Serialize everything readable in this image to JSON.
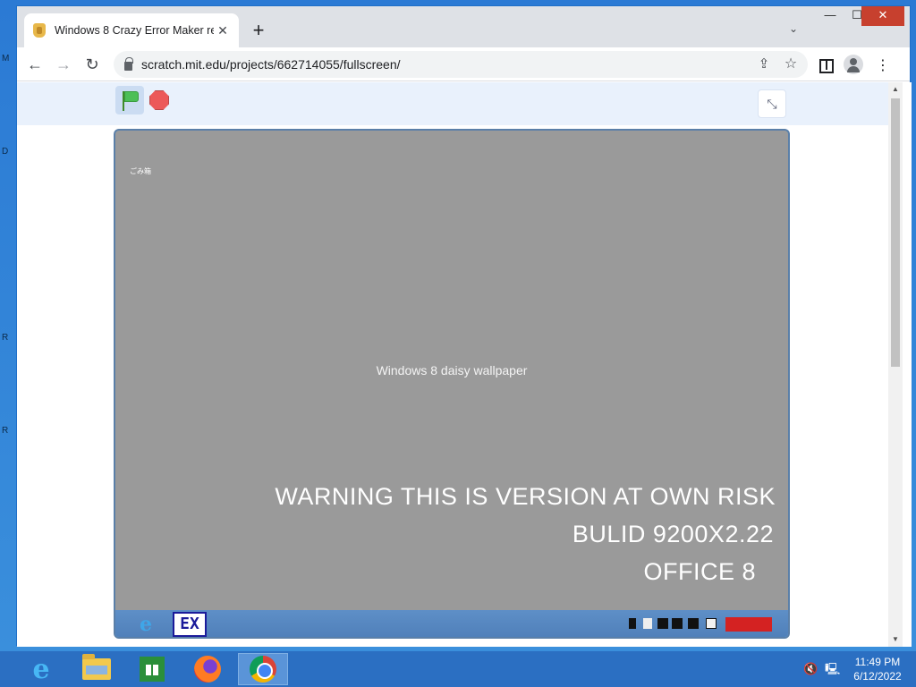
{
  "host": {
    "edge_letters": [
      "M",
      "D",
      "R",
      "R"
    ]
  },
  "browser": {
    "tab": {
      "title": "Windows 8 Crazy Error Maker re",
      "close_label": "✕"
    },
    "new_tab_label": "+",
    "tab_search_label": "⌄",
    "window_controls": {
      "minimize": "—",
      "maximize": "☐",
      "close": "✕"
    },
    "nav": {
      "back": "←",
      "forward": "→",
      "reload": "↻"
    },
    "url": "scratch.mit.edu/projects/662714055/fullscreen/",
    "icons": {
      "share": "⇪",
      "star": "☆",
      "menu": "⋮"
    }
  },
  "scratch": {
    "fullscreen_label": "⤡",
    "stage": {
      "wallpaper_label": "Windows 8 daisy wallpaper",
      "recycle_bin_label": "ごみ箱",
      "warning_lines": [
        "WARNING THIS IS VERSION AT OWN RISK",
        "BULID 9200X2.22",
        "OFFICE 8"
      ],
      "taskbar": {
        "ie_label": "e",
        "ex_label": "EX"
      }
    }
  },
  "taskbar": {
    "ie_label": "e",
    "volume_icon": "🔇",
    "network_icon": "🖳",
    "time": "11:49 PM",
    "date": "6/12/2022"
  },
  "colors": {
    "window_border": "#1f6fc8",
    "taskbar": "#2b6fc2",
    "stage_sky": "#4ea3ef",
    "scratch_controls": "#e9f1fc"
  }
}
